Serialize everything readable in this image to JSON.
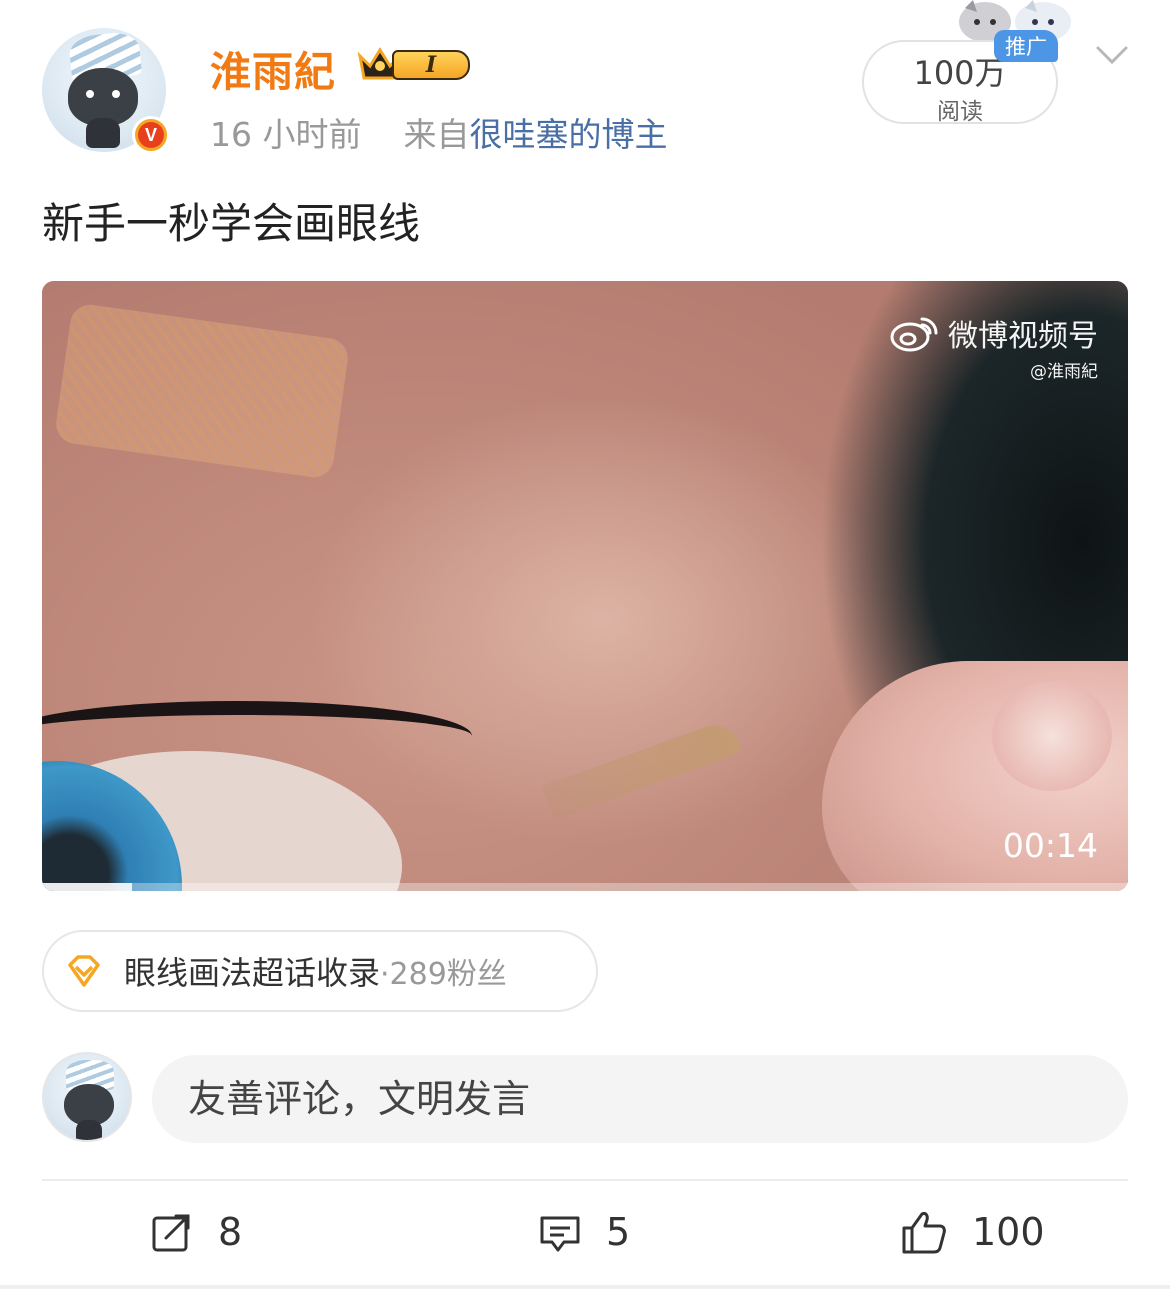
{
  "post": {
    "author": {
      "name": "淮雨紀",
      "level_badge": "I",
      "verified_badge": "V"
    },
    "meta": {
      "time": "16 小时前",
      "from_prefix": "来自",
      "from_source": "很哇塞的博主"
    },
    "reads": {
      "count": "100万",
      "label": "阅读",
      "promo_tag": "推广"
    },
    "text": "新手一秒学会画眼线",
    "video": {
      "watermark_title": "微博视频号",
      "watermark_handle": "@淮雨紀",
      "duration": "00:14",
      "progress_fraction": 0.083
    },
    "topic": {
      "name": "眼线画法超话收录",
      "fans": "·289粉丝"
    }
  },
  "comment": {
    "placeholder": "友善评论，文明发言"
  },
  "actions": {
    "repost_count": "8",
    "comment_count": "5",
    "like_count": "100"
  },
  "colors": {
    "username": "#f27a12",
    "link": "#4a6fa5",
    "promo": "#4d95e5",
    "topic_icon": "#f5a623"
  },
  "icons": {
    "verified": "verified-v-icon",
    "level": "crown-level-icon",
    "more": "chevron-down-icon",
    "weibo": "weibo-logo-icon",
    "topic": "diamond-icon",
    "repost": "repost-icon",
    "comment": "comment-icon",
    "like": "thumbs-up-icon"
  }
}
